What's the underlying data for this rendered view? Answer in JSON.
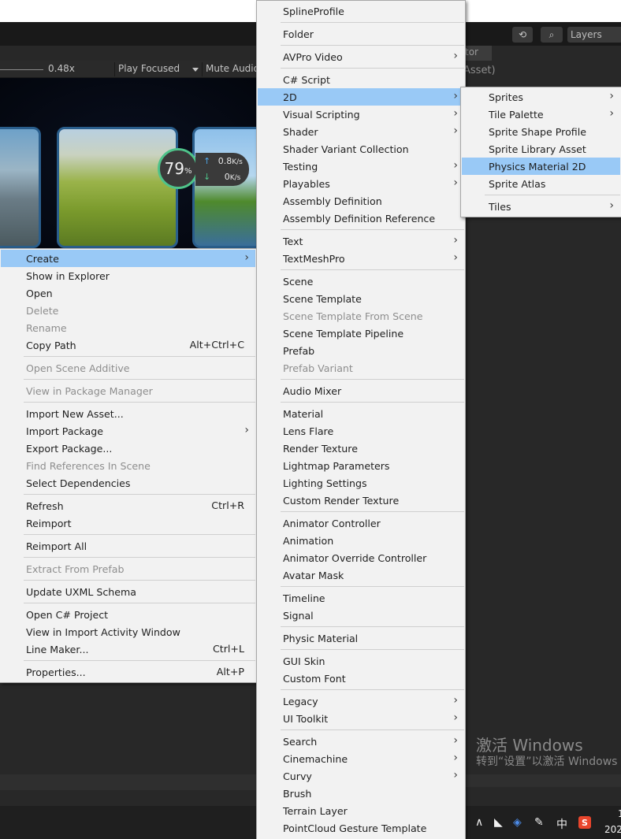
{
  "editor": {
    "layers_label": "Layers",
    "zoom_value": "0.48x",
    "play_focused": "Play Focused",
    "mute_audio": "Mute Audio",
    "inspector_tab": "tor",
    "asset_label": "Asset)",
    "gauge_value": "79",
    "gauge_unit": "%",
    "speed_up": "0.8",
    "speed_down": "0",
    "speed_unit": "K/s",
    "watermark_title": "激活 Windows",
    "watermark_sub": "转到“设置”以激活 Windows",
    "tray_ime": "中",
    "clock_year": "202",
    "clock_top": "1"
  },
  "context_menu": [
    {
      "label": "Create",
      "submenu": true,
      "highlight": true
    },
    {
      "label": "Show in Explorer"
    },
    {
      "label": "Open"
    },
    {
      "label": "Delete",
      "disabled": true
    },
    {
      "label": "Rename",
      "disabled": true
    },
    {
      "label": "Copy Path",
      "shortcut": "Alt+Ctrl+C"
    },
    {
      "separator": true
    },
    {
      "label": "Open Scene Additive",
      "disabled": true
    },
    {
      "separator": true
    },
    {
      "label": "View in Package Manager",
      "disabled": true
    },
    {
      "separator": true
    },
    {
      "label": "Import New Asset..."
    },
    {
      "label": "Import Package",
      "submenu": true
    },
    {
      "label": "Export Package..."
    },
    {
      "label": "Find References In Scene",
      "disabled": true
    },
    {
      "label": "Select Dependencies"
    },
    {
      "separator": true
    },
    {
      "label": "Refresh",
      "shortcut": "Ctrl+R"
    },
    {
      "label": "Reimport"
    },
    {
      "separator": true
    },
    {
      "label": "Reimport All"
    },
    {
      "separator": true
    },
    {
      "label": "Extract From Prefab",
      "disabled": true
    },
    {
      "separator": true
    },
    {
      "label": "Update UXML Schema"
    },
    {
      "separator": true
    },
    {
      "label": "Open C# Project"
    },
    {
      "label": "View in Import Activity Window"
    },
    {
      "label": "Line Maker...",
      "shortcut": "Ctrl+L"
    },
    {
      "separator": true
    },
    {
      "label": "Properties...",
      "shortcut": "Alt+P"
    }
  ],
  "create_menu": [
    {
      "label": "SplineProfile"
    },
    {
      "separator": true
    },
    {
      "label": "Folder"
    },
    {
      "separator": true
    },
    {
      "label": "AVPro Video",
      "submenu": true
    },
    {
      "separator": true
    },
    {
      "label": "C# Script"
    },
    {
      "label": "2D",
      "submenu": true,
      "highlight": true
    },
    {
      "label": "Visual Scripting",
      "submenu": true
    },
    {
      "label": "Shader",
      "submenu": true
    },
    {
      "label": "Shader Variant Collection"
    },
    {
      "label": "Testing",
      "submenu": true
    },
    {
      "label": "Playables",
      "submenu": true
    },
    {
      "label": "Assembly Definition"
    },
    {
      "label": "Assembly Definition Reference"
    },
    {
      "separator": true
    },
    {
      "label": "Text",
      "submenu": true
    },
    {
      "label": "TextMeshPro",
      "submenu": true
    },
    {
      "separator": true
    },
    {
      "label": "Scene"
    },
    {
      "label": "Scene Template"
    },
    {
      "label": "Scene Template From Scene",
      "disabled": true
    },
    {
      "label": "Scene Template Pipeline"
    },
    {
      "label": "Prefab"
    },
    {
      "label": "Prefab Variant",
      "disabled": true
    },
    {
      "separator": true
    },
    {
      "label": "Audio Mixer"
    },
    {
      "separator": true
    },
    {
      "label": "Material"
    },
    {
      "label": "Lens Flare"
    },
    {
      "label": "Render Texture"
    },
    {
      "label": "Lightmap Parameters"
    },
    {
      "label": "Lighting Settings"
    },
    {
      "label": "Custom Render Texture"
    },
    {
      "separator": true
    },
    {
      "label": "Animator Controller"
    },
    {
      "label": "Animation"
    },
    {
      "label": "Animator Override Controller"
    },
    {
      "label": "Avatar Mask"
    },
    {
      "separator": true
    },
    {
      "label": "Timeline"
    },
    {
      "label": "Signal"
    },
    {
      "separator": true
    },
    {
      "label": "Physic Material"
    },
    {
      "separator": true
    },
    {
      "label": "GUI Skin"
    },
    {
      "label": "Custom Font"
    },
    {
      "separator": true
    },
    {
      "label": "Legacy",
      "submenu": true
    },
    {
      "label": "UI Toolkit",
      "submenu": true
    },
    {
      "separator": true
    },
    {
      "label": "Search",
      "submenu": true
    },
    {
      "label": "Cinemachine",
      "submenu": true
    },
    {
      "label": "Curvy",
      "submenu": true
    },
    {
      "label": "Brush"
    },
    {
      "label": "Terrain Layer"
    },
    {
      "label": "PointCloud Gesture Template"
    }
  ],
  "twod_menu": [
    {
      "label": "Sprites",
      "submenu": true
    },
    {
      "label": "Tile Palette",
      "submenu": true
    },
    {
      "label": "Sprite Shape Profile"
    },
    {
      "label": "Sprite Library Asset"
    },
    {
      "label": "Physics Material 2D",
      "highlight": true
    },
    {
      "label": "Sprite Atlas"
    },
    {
      "separator": true
    },
    {
      "label": "Tiles",
      "submenu": true
    }
  ]
}
